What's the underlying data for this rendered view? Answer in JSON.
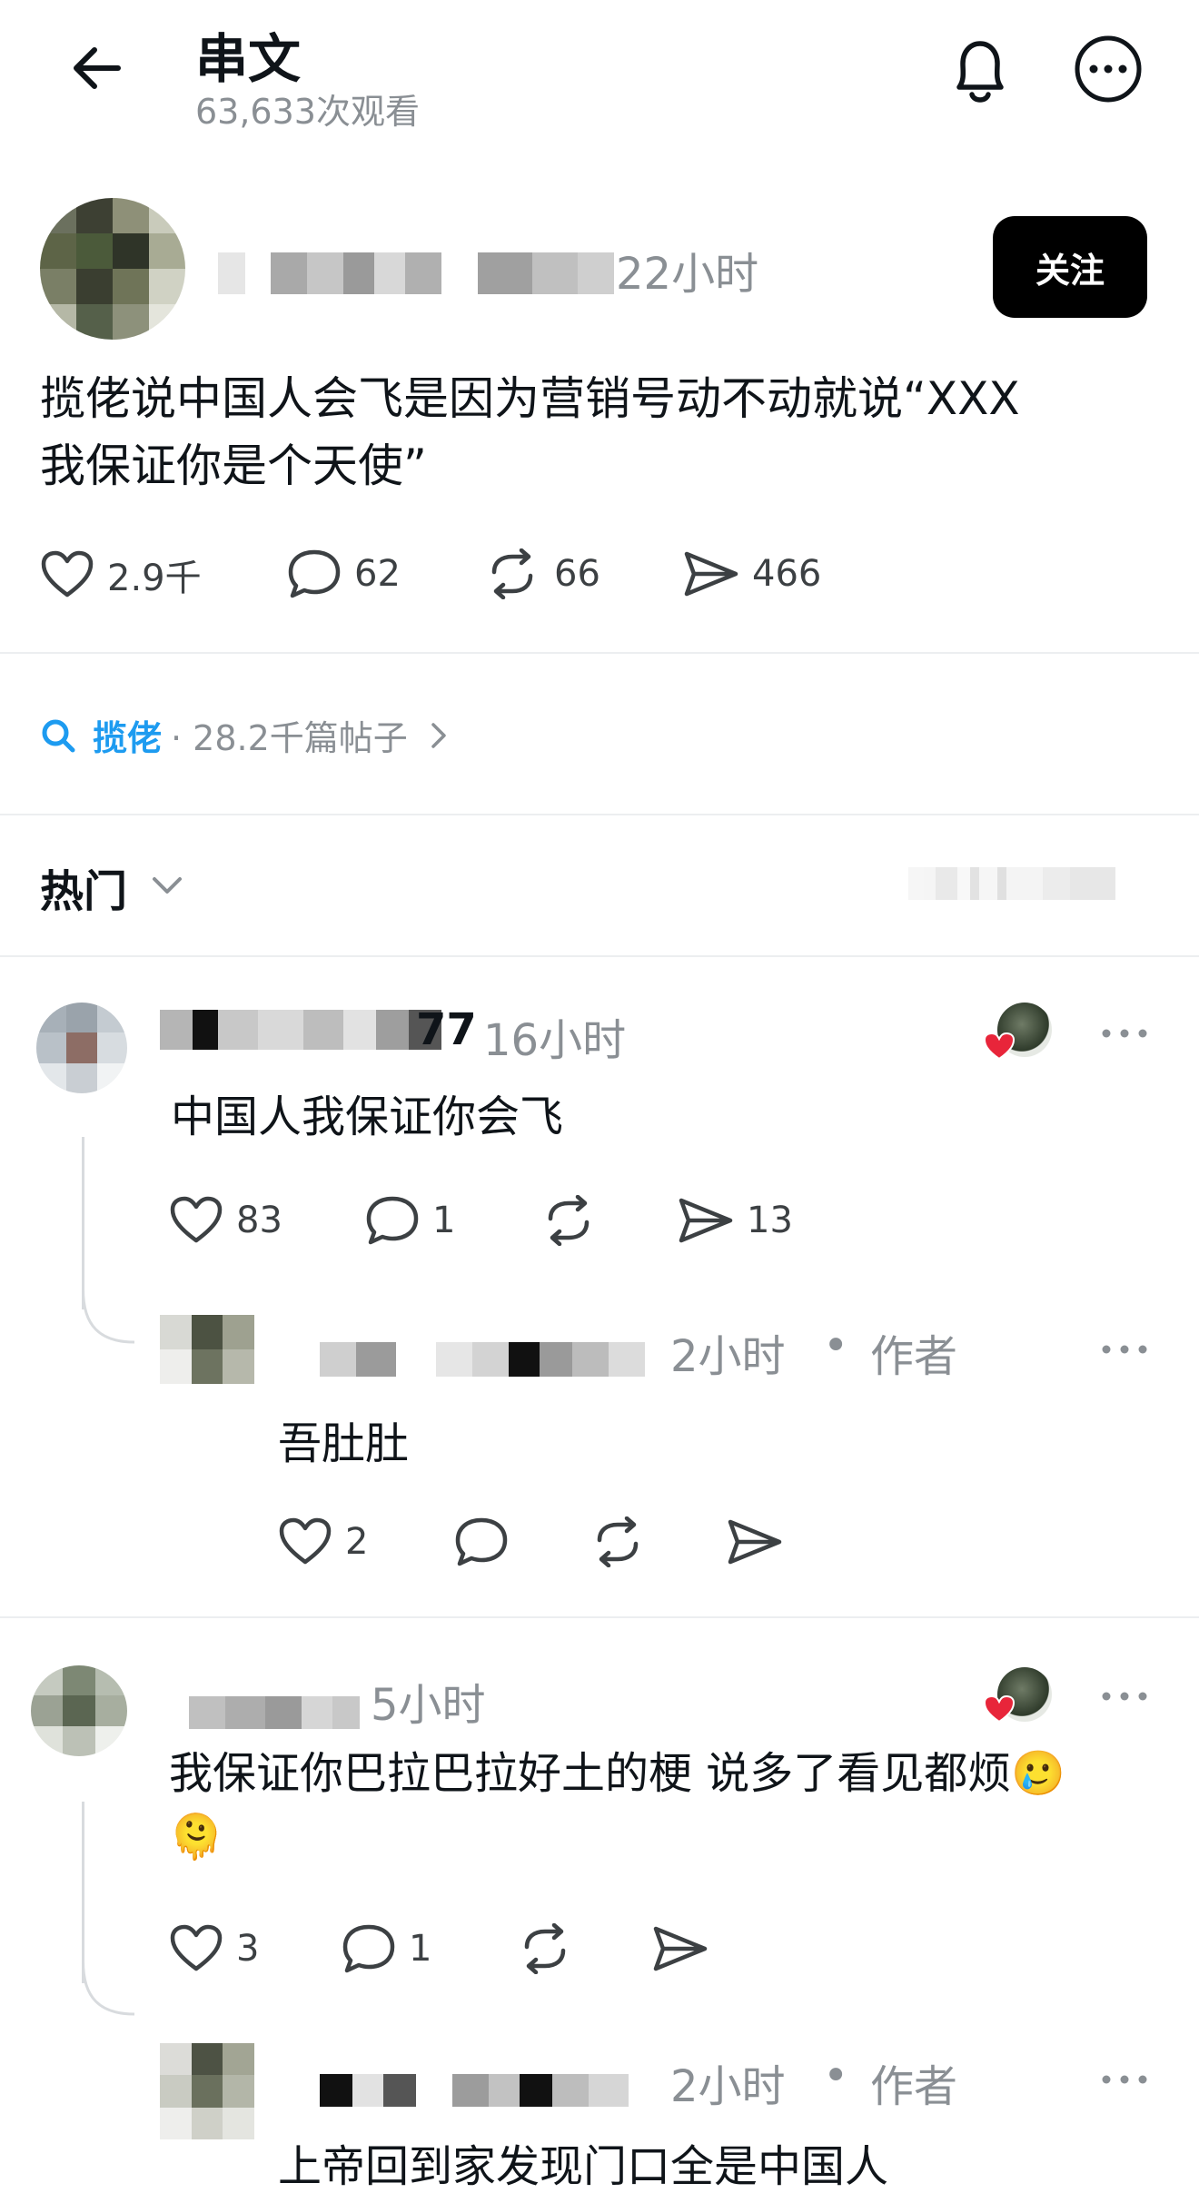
{
  "header": {
    "title": "串文",
    "views": "63,633次观看"
  },
  "post": {
    "time": "22小时",
    "follow_label": "关注",
    "text_line1": "揽佬说中国人会飞是因为营销号动不动就说“XXX",
    "text_line2": "我保证你是个天使”",
    "likes": "2.9千",
    "comments": "62",
    "reposts": "66",
    "shares": "466"
  },
  "topic": {
    "name": "揽佬",
    "meta": "· 28.2千篇帖子"
  },
  "sort": {
    "label": "热门"
  },
  "comments": [
    {
      "name_suffix": "77",
      "time": "16小时",
      "text": "中国人我保证你会飞",
      "likes": "83",
      "replies": "1",
      "shares": "13"
    },
    {
      "time": "2小时",
      "author_tag": "作者",
      "text": "吾肚肚",
      "likes": "2"
    },
    {
      "time": "5小时",
      "text_line1": "我保证你巴拉巴拉好土的梗 说多了看见都烦🥲",
      "text_line2": "🫠",
      "likes": "3",
      "replies": "1"
    },
    {
      "time": "2小时",
      "author_tag": "作者",
      "text": "上帝回到家发现门口全是中国人"
    }
  ],
  "icons": [
    "back-arrow-icon",
    "bell-icon",
    "more-icon",
    "heart-icon",
    "comment-icon",
    "repost-icon",
    "share-icon",
    "search-icon",
    "chevron-right-icon",
    "chevron-down-icon",
    "liked-by-author-heart-icon"
  ],
  "colors": {
    "accent": "#1d9bf0",
    "text": "#0f1419",
    "muted": "#8a8f94",
    "heart_red": "#e8253a"
  }
}
